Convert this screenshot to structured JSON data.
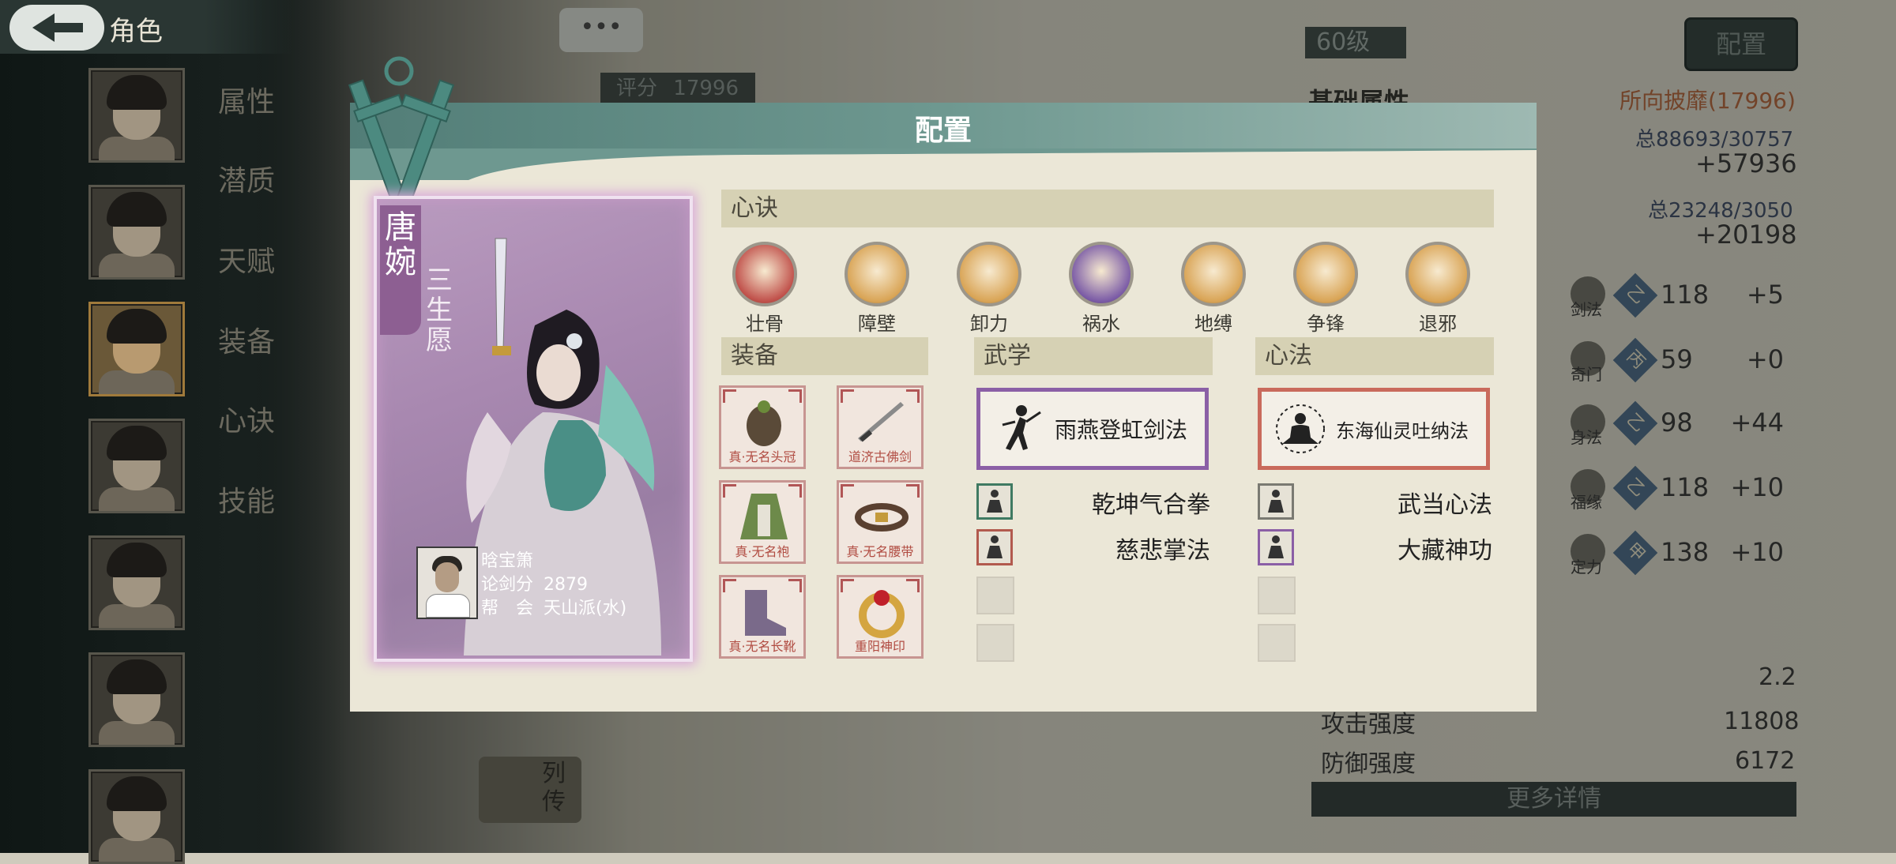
{
  "app": {
    "title": "角色"
  },
  "sidebar": {
    "tabs": [
      "属性",
      "潜质",
      "天赋",
      "装备",
      "心诀",
      "技能"
    ]
  },
  "background": {
    "chat_icon": "•••",
    "score_label": "评分",
    "score_value": "17996",
    "level": "60级",
    "config_button": "配置",
    "base_attr_title": "基础属性",
    "title_tag": "所向披靡(17996)",
    "total_1": "总88693/30757",
    "bonus_1": "+57936",
    "total_2": "总23248/3050",
    "bonus_2": "+20198",
    "attributes": [
      {
        "name": "剑法",
        "grade": "乙",
        "value": "118",
        "delta": "+5"
      },
      {
        "name": "奇门",
        "grade": "丙",
        "value": "59",
        "delta": "+0"
      },
      {
        "name": "身法",
        "grade": "乙",
        "value": "98",
        "delta": "+44"
      },
      {
        "name": "福缘",
        "grade": "乙",
        "value": "118",
        "delta": "+10"
      },
      {
        "name": "定力",
        "grade": "甲",
        "value": "138",
        "delta": "+10"
      }
    ],
    "stat_rows": [
      {
        "label": "",
        "value": "2.2"
      },
      {
        "label": "攻击强度",
        "value": "11808"
      },
      {
        "label": "防御强度",
        "value": "6172"
      }
    ],
    "more_details": "更多详情",
    "liezhuan": "列传"
  },
  "modal": {
    "title": "配置",
    "character": {
      "name": "唐婉",
      "vow": "三生愿",
      "player_name": "晗宝箫",
      "sword_score_label": "论剑分",
      "sword_score": "2879",
      "guild_label": "帮　会",
      "guild": "天山派(水)"
    },
    "xinjue": {
      "header": "心诀",
      "skills": [
        {
          "label": "壮骨",
          "icon": "red-rune-icon",
          "color": "#c0504a"
        },
        {
          "label": "障壁",
          "icon": "shield-wall-icon",
          "color": "#d9a455"
        },
        {
          "label": "卸力",
          "icon": "swirl-icon",
          "color": "#d9a455"
        },
        {
          "label": "祸水",
          "icon": "purple-figure-icon",
          "color": "#7a5aa6"
        },
        {
          "label": "地缚",
          "icon": "spiral-icon",
          "color": "#d9a455"
        },
        {
          "label": "争锋",
          "icon": "fist-icon",
          "color": "#d9a455"
        },
        {
          "label": "退邪",
          "icon": "gate-icon",
          "color": "#d9a455"
        }
      ]
    },
    "equipment": {
      "header": "装备",
      "items": [
        {
          "label": "真·无名头冠",
          "icon": "crown-icon"
        },
        {
          "label": "道济古佛剑",
          "icon": "sword-icon"
        },
        {
          "label": "真·无名袍",
          "icon": "robe-icon"
        },
        {
          "label": "真·无名腰带",
          "icon": "belt-icon"
        },
        {
          "label": "真·无名长靴",
          "icon": "boots-icon"
        },
        {
          "label": "重阳神印",
          "icon": "ring-icon"
        }
      ]
    },
    "martial": {
      "header": "武学",
      "main": "雨燕登虹剑法",
      "main_color": "#8b5fa6",
      "secondary": [
        {
          "label": "乾坤气合拳",
          "border": "#3f7a62"
        },
        {
          "label": "慈悲掌法",
          "border": "#b25a4e"
        }
      ]
    },
    "mental": {
      "header": "心法",
      "main": "东海仙灵吐纳法",
      "main_color": "#c96a5c",
      "secondary": [
        {
          "label": "武当心法",
          "border": "#7a7a72"
        },
        {
          "label": "大藏神功",
          "border": "#8b5fa6"
        }
      ]
    }
  }
}
